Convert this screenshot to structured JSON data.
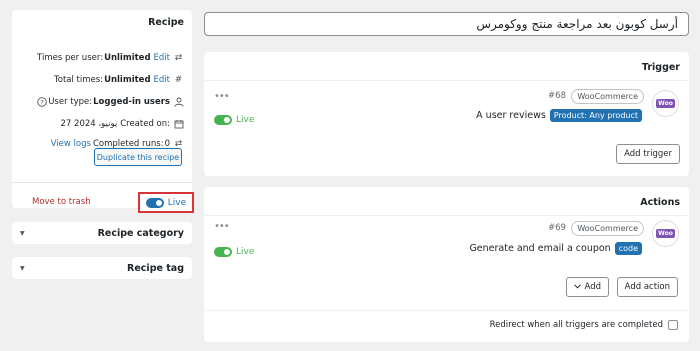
{
  "recipe_panel": {
    "title": "Recipe",
    "times_per_user": {
      "label": "Times per user:",
      "value": "Unlimited",
      "edit": "Edit",
      "icon": "repeat-icon"
    },
    "total_times": {
      "label": "Total times:",
      "value": "Unlimited",
      "edit": "Edit",
      "icon": "hash-icon"
    },
    "user_type": {
      "label": "User type:",
      "value": "Logged-in users",
      "icon": "user-icon"
    },
    "created_on": {
      "value": "27 يونيو، 2024",
      "label": "Created on:",
      "icon": "calendar-icon"
    },
    "completed_runs": {
      "view_logs": "View logs",
      "label": "Completed runs:",
      "value": "0",
      "icon": "repeat-icon"
    },
    "duplicate_button": "Duplicate this recipe",
    "move_to_trash": "Move to trash",
    "live_toggle": "Live"
  },
  "recipe_category": {
    "title": "Recipe category"
  },
  "recipe_tag": {
    "title": "Recipe tag"
  },
  "recipe_title": "أرسل كوبون بعد مراجعة منتج ووكومرس",
  "trigger": {
    "section_title": "Trigger",
    "item": {
      "number": "#68",
      "integration": "WooCommerce",
      "description": "A user reviews",
      "token": "Product: Any product",
      "status": "Live"
    },
    "add_button": "Add trigger"
  },
  "actions": {
    "section_title": "Actions",
    "item": {
      "number": "#69",
      "integration": "WooCommerce",
      "description": "Generate and email a coupon",
      "token": "code",
      "status": "Live"
    },
    "add_dropdown": "Add",
    "add_action_button": "Add action",
    "redirect_label": "Redirect when all triggers are completed"
  },
  "colors": {
    "accent": "#2271b1",
    "live_green": "#46b450",
    "trash_red": "#b32d2e",
    "woo_purple": "#7f54b3"
  }
}
